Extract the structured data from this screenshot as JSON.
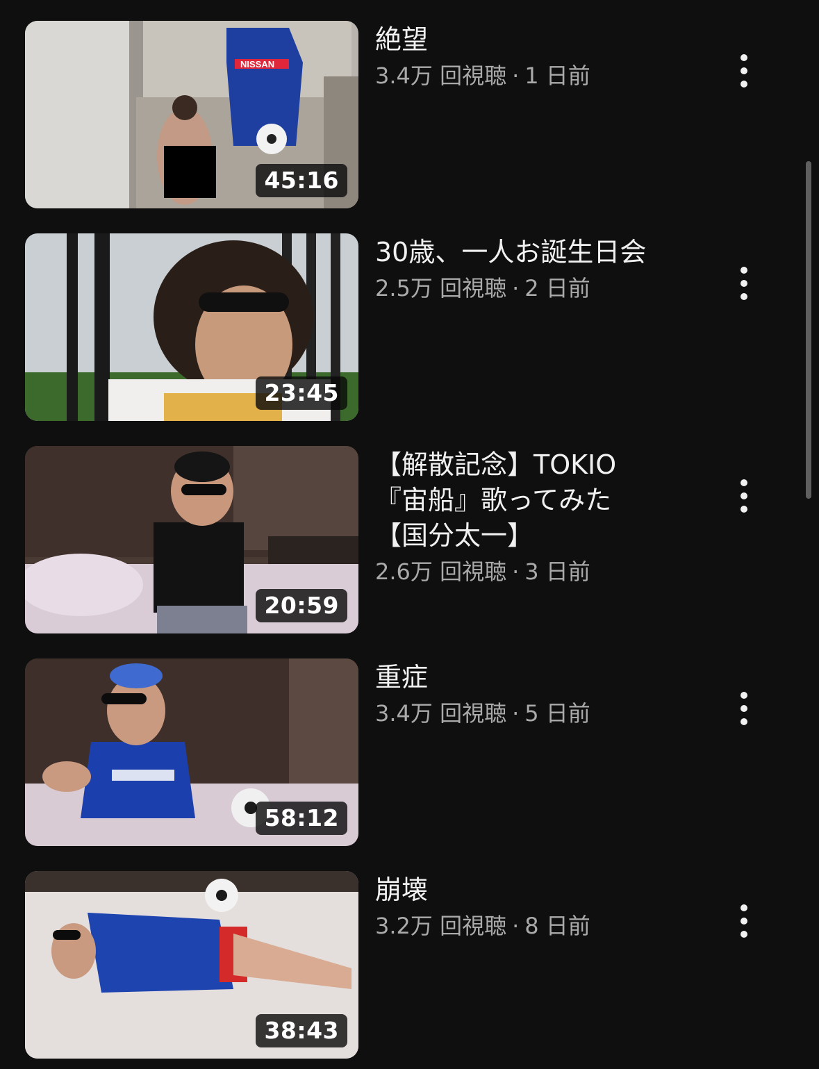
{
  "videos": [
    {
      "title_lines": [
        "絶望"
      ],
      "views": "3.4万 回視聴",
      "age": "1 日前",
      "duration": "45:16"
    },
    {
      "title_lines": [
        "30歳、一人お誕生日会"
      ],
      "views": "2.5万 回視聴",
      "age": "2 日前",
      "duration": "23:45"
    },
    {
      "title_lines": [
        "【解散記念】TOKIO",
        "『宙船』歌ってみた",
        "【国分太一】"
      ],
      "views": "2.6万 回視聴",
      "age": "3 日前",
      "duration": "20:59"
    },
    {
      "title_lines": [
        "重症"
      ],
      "views": "3.4万 回視聴",
      "age": "5 日前",
      "duration": "58:12"
    },
    {
      "title_lines": [
        "崩壊"
      ],
      "views": "3.2万 回視聴",
      "age": "8 日前",
      "duration": "38:43"
    }
  ],
  "meta_separator": "·",
  "thumbnail_texts": {
    "jersey_print": "NISSAN"
  },
  "colors": {
    "background": "#0f0f0f",
    "title": "#f1f1f1",
    "meta": "#aaaaaa"
  }
}
